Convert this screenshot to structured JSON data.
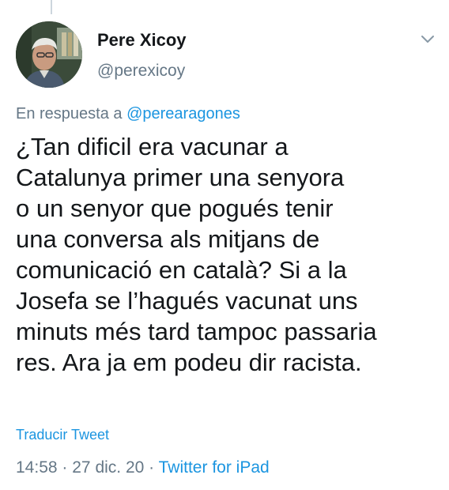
{
  "user": {
    "name": "Pere Xicoy",
    "handle": "@perexicoy",
    "avatar_icon": "profile-photo"
  },
  "reply": {
    "prefix": "En respuesta a",
    "mention": "@perearagones"
  },
  "tweet": {
    "lines": [
      "¿Tan dificil era vacunar a",
      "Catalunya primer una senyora",
      "o un senyor que pogués tenir",
      "una conversa als mitjans de",
      "comunicació en català? Si a la",
      "Josefa se l’hagués vacunat uns",
      "minuts més tard tampoc passaria",
      "res. Ara ja em podeu dir racista."
    ]
  },
  "translate_label": "Traducir Tweet",
  "meta": {
    "time": "14:58",
    "date": "27 dic. 20",
    "separator": "·",
    "source": "Twitter for iPad"
  },
  "colors": {
    "link": "#1b95e0",
    "secondary_text": "#657786",
    "primary_text": "#14171a"
  },
  "icons": {
    "more": "chevron-down-icon"
  }
}
